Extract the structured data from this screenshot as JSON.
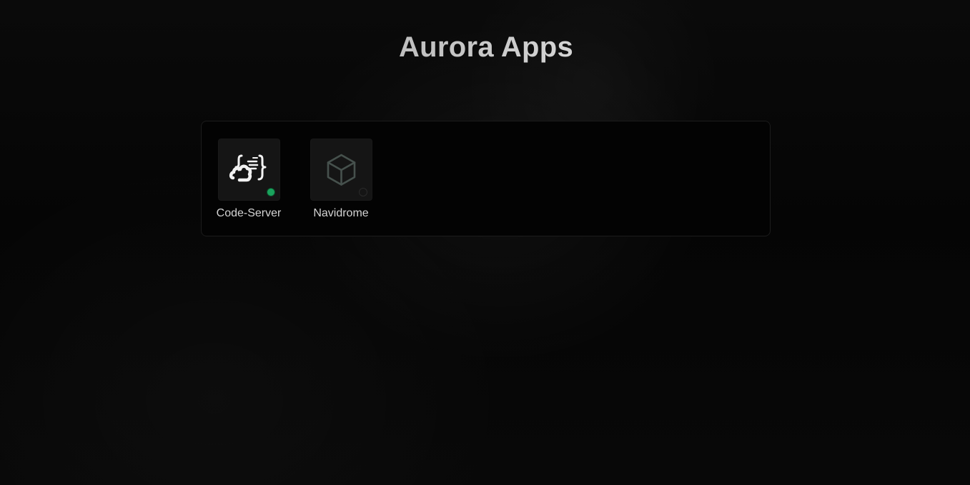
{
  "page": {
    "title": "Aurora Apps"
  },
  "apps": [
    {
      "name": "Code-Server",
      "icon": "code-server-logo-icon",
      "status": "online",
      "status_color": "#1aa35d"
    },
    {
      "name": "Navidrome",
      "icon": "cube-icon",
      "status": "offline",
      "status_color": "#2a2a2a"
    }
  ],
  "theme": {
    "background": "#050505",
    "panel_background": "#030303",
    "tile_background": "#151515",
    "text": "#d4d4d4"
  }
}
